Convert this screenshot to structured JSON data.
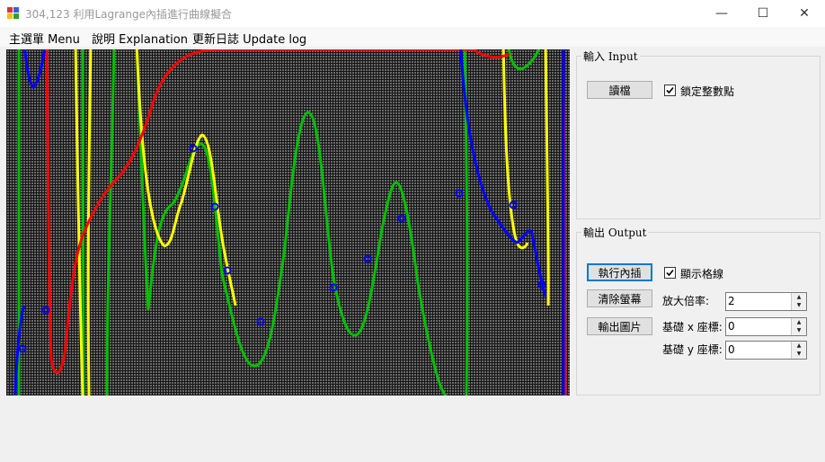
{
  "window": {
    "title": "304,123 利用Lagrange內插進行曲線擬合",
    "minimize_glyph": "—",
    "maximize_glyph": "☐",
    "close_glyph": "✕"
  },
  "menu": {
    "items": [
      {
        "label": "主選單 Menu"
      },
      {
        "label": "說明 Explanation"
      },
      {
        "label": "更新日誌 Update log"
      }
    ]
  },
  "input_group": {
    "title": "輸入 Input",
    "read_button": "讀檔",
    "lock_label": "鎖定整數點",
    "lock_checked": true
  },
  "output_group": {
    "title": "輸出 Output",
    "execute_button": "執行內插",
    "clear_button": "清除螢幕",
    "export_button": "輸出圖片",
    "grid_label": "顯示格線",
    "grid_checked": true,
    "zoom_label": "放大倍率:",
    "zoom_value": "2",
    "base_x_label": "基礎 x 座標:",
    "base_x_value": "0",
    "base_y_label": "基礎 y 座標:",
    "base_y_value": "0"
  },
  "colors": {
    "canvas_bg": "#505050",
    "grid": "#000000",
    "red": "#ff0000",
    "yellow": "#ffff00",
    "green": "#00c000",
    "blue": "#0000ff"
  }
}
